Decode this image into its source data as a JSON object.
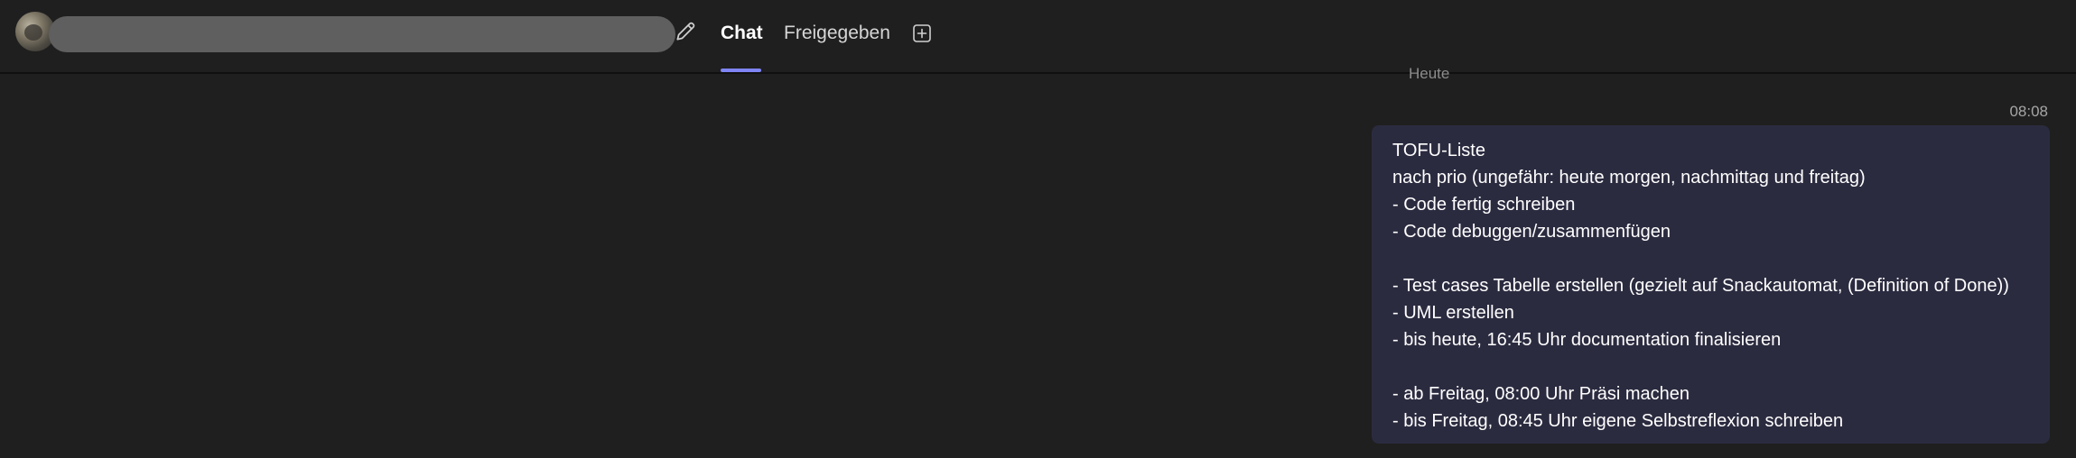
{
  "header": {
    "tabs": [
      {
        "label": "Chat",
        "active": true
      },
      {
        "label": "Freigegeben",
        "active": false
      }
    ],
    "accent_color": "#7f85f5"
  },
  "icons": {
    "edit": "pencil-icon",
    "add_tab": "plus-square-icon"
  },
  "chat": {
    "date_divider": "Heute",
    "messages": [
      {
        "time": "08:08",
        "bubble_color": "#2b2b40",
        "lines": [
          "TOFU-Liste",
          "nach prio (ungefähr: heute morgen, nachmittag und freitag)",
          "- Code fertig schreiben",
          "- Code debuggen/zusammenfügen",
          "",
          "- Test cases Tabelle erstellen (gezielt auf Snackautomat, (Definition of Done))",
          "- UML erstellen",
          "- bis heute, 16:45 Uhr documentation finalisieren",
          "",
          "- ab Freitag, 08:00 Uhr Präsi machen",
          "- bis Freitag, 08:45 Uhr eigene Selbstreflexion schreiben"
        ]
      }
    ]
  }
}
